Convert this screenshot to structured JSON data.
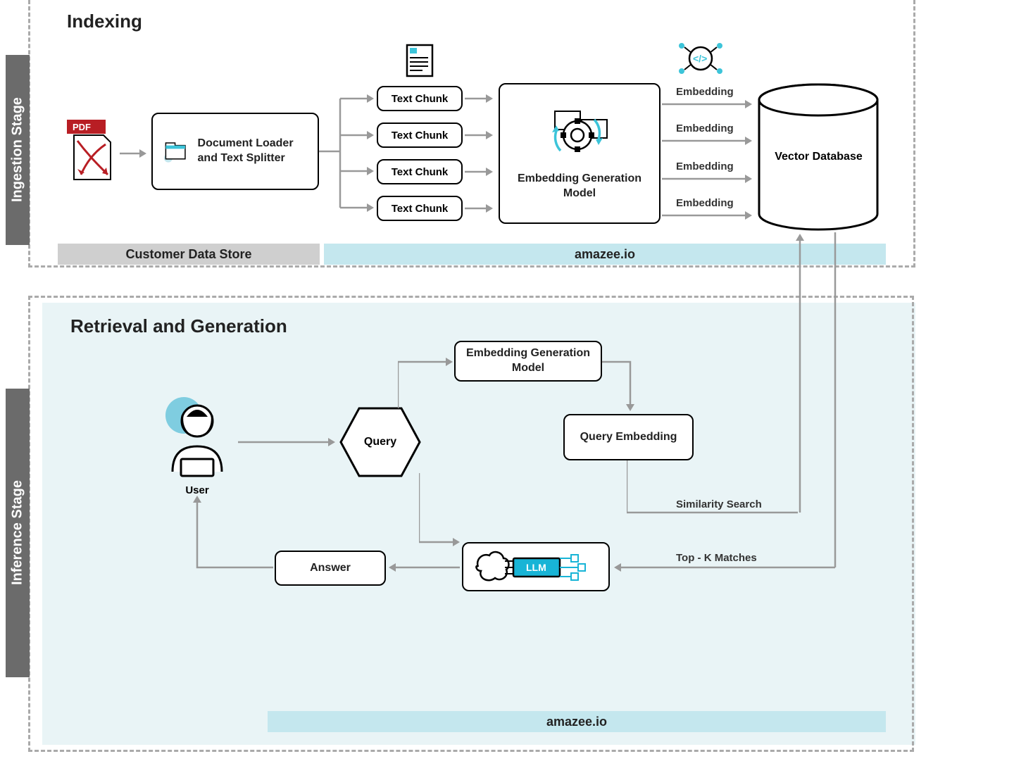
{
  "stages": {
    "ingestion": "Ingestion Stage",
    "inference": "Inference Stage"
  },
  "sections": {
    "indexing": "Indexing",
    "retrieval": "Retrieval and Generation"
  },
  "nodes": {
    "pdf_badge": "PDF",
    "doc_loader": "Document Loader and Text Splitter",
    "text_chunk": "Text Chunk",
    "embedding_model": "Embedding Generation Model",
    "embedding_label": "Embedding",
    "vector_db": "Vector Database",
    "user": "User",
    "query": "Query",
    "embedding_model_small": "Embedding Generation Model",
    "query_embedding": "Query Embedding",
    "similarity_search": "Similarity Search",
    "top_k": "Top - K Matches",
    "llm": "LLM",
    "answer": "Answer"
  },
  "bars": {
    "customer_store": "Customer Data Store",
    "amazee_top": "amazee.io",
    "amazee_bottom": "amazee.io"
  }
}
